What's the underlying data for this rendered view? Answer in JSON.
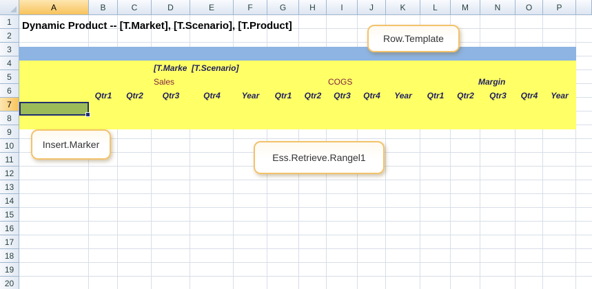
{
  "columns": [
    "A",
    "B",
    "C",
    "D",
    "E",
    "F",
    "G",
    "H",
    "I",
    "J",
    "K",
    "L",
    "M",
    "N",
    "O",
    "P"
  ],
  "selected_column": "A",
  "rows": [
    "1",
    "2",
    "3",
    "4",
    "5",
    "6",
    "7",
    "8",
    "9",
    "10",
    "11",
    "12",
    "13",
    "14",
    "15",
    "16",
    "17",
    "18",
    "19",
    "20"
  ],
  "selected_row": "7",
  "colors": {
    "template_band": "#8db4e2",
    "retrieve_range": "#ffff66",
    "insert_marker": "#9bbb59"
  },
  "cells": {
    "title": "Dynamic Product -- [T.Market], [T.Scenario], [T.Product]",
    "d4_market": "[T.Marke",
    "e4_scenario": "[T.Scenario]",
    "sales": "Sales",
    "cogs": "COGS",
    "margin": "Margin",
    "periods": [
      "Qtr1",
      "Qtr2",
      "Qtr3",
      "Qtr4",
      "Year",
      "Qtr1",
      "Qtr2",
      "Qtr3",
      "Qtr4",
      "Year",
      "Qtr1",
      "Qtr2",
      "Qtr3",
      "Qtr4",
      "Year"
    ]
  },
  "callouts": {
    "row_template": "Row.Template",
    "insert_marker": "Insert.Marker",
    "retrieve_range": "Ess.Retrieve.Rangel1"
  }
}
